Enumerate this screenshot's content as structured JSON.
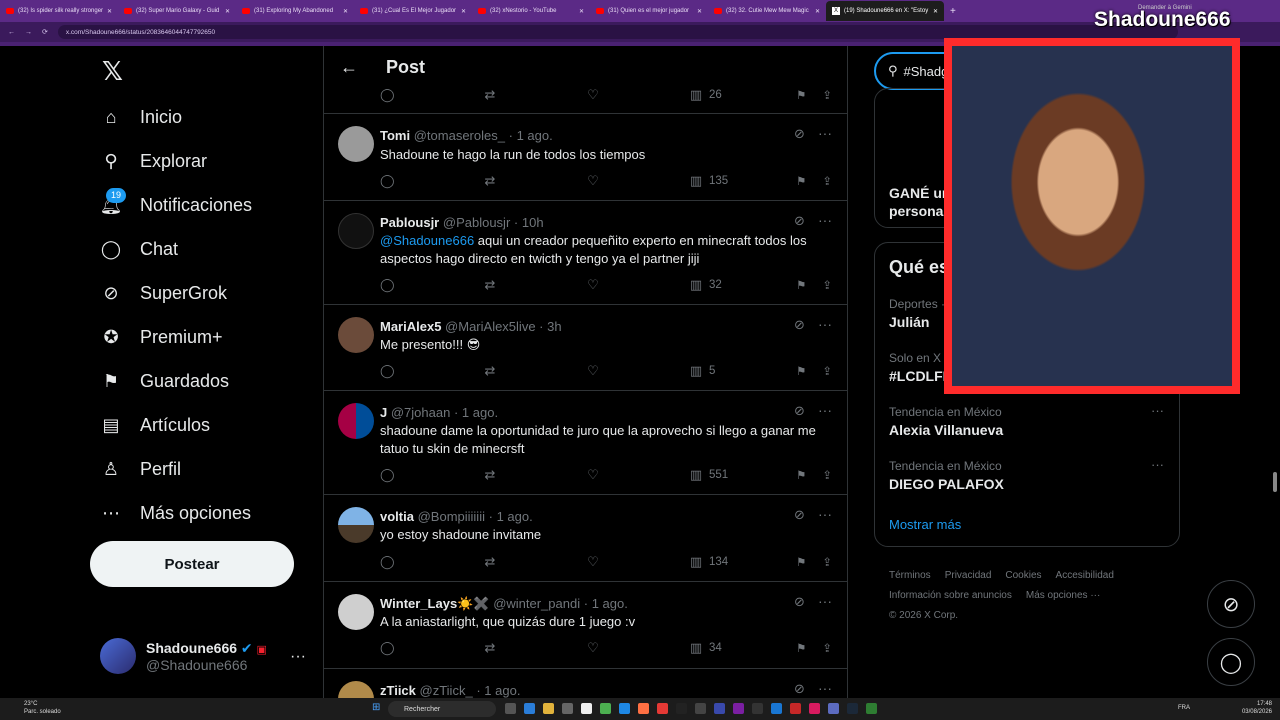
{
  "browser": {
    "tabs": [
      {
        "label": "(32) Is spider silk really stronger"
      },
      {
        "label": "(32) Super Mario Galaxy - Guid"
      },
      {
        "label": "(31) Exploring My Abandoned"
      },
      {
        "label": "(31) ¿Cual Es El Mejor Jugador"
      },
      {
        "label": "(32) xNestorio - YouTube"
      },
      {
        "label": "(31) Quien es el mejor jugador"
      },
      {
        "label": "(32) 32. Cutie Mew Mew Magic"
      },
      {
        "label": "(19) Shadoune666 en X: \"Estoy"
      }
    ],
    "url": "x.com/Shadoune666/status/2083646044747792650"
  },
  "overlay": {
    "streamer_name": "Shadoune666",
    "hint": "Demander à Gemini"
  },
  "nav": {
    "items": [
      {
        "label": "Inicio"
      },
      {
        "label": "Explorar"
      },
      {
        "label": "Notificaciones"
      },
      {
        "label": "Chat"
      },
      {
        "label": "SuperGrok"
      },
      {
        "label": "Premium+"
      },
      {
        "label": "Guardados"
      },
      {
        "label": "Artículos"
      },
      {
        "label": "Perfil"
      },
      {
        "label": "Más opciones"
      }
    ],
    "notif_badge": "19",
    "post_button": "Postear",
    "account": {
      "name": "Shadoune666",
      "handle": "@Shadoune666"
    }
  },
  "header": {
    "title": "Post"
  },
  "top_actions": {
    "views": "26"
  },
  "tweets": [
    {
      "name": "Tomi",
      "handle": "@tomaseroles_",
      "time": "1 ago.",
      "text": "Shadoune te hago la run de todos los tiempos",
      "views": "135"
    },
    {
      "name": "Pablousjr",
      "handle": "@Pablousjr",
      "time": "10h",
      "mention": "@Shadoune666",
      "text": " aqui un creador pequeñito experto en minecraft todos los aspectos hago directo en twicth y tengo ya el partner jiji",
      "views": "32"
    },
    {
      "name": "MariAlex5",
      "handle": "@MariAlex5live",
      "time": "3h",
      "text": "Me presento!!! 😎",
      "views": "5"
    },
    {
      "name": "J",
      "handle": "@7johaan",
      "time": "1 ago.",
      "text": "shadoune dame la oportunidad te juro que la aprovecho si llego a ganar me tatuo tu skin de minecrsft",
      "views": "551"
    },
    {
      "name": "voltia",
      "handle": "@Bompiiiiiii",
      "time": "1 ago.",
      "text": "yo estoy shadoune invitame",
      "views": "134"
    },
    {
      "name": "Winter_Lays☀️✖️",
      "handle": "@winter_pandi",
      "time": "1 ago.",
      "text": "A la aniastarlight, que quizás dure 1 juego :v",
      "views": "34"
    },
    {
      "name": "zTiick",
      "handle": "@zTiick_",
      "time": "1 ago."
    }
  ],
  "right": {
    "search_value": "#Shadg",
    "card1_text": [
      "GANÉ un",
      "personas"
    ],
    "trends_title": "Qué es",
    "trends": [
      {
        "context": "Deportes ·",
        "name": "Julián"
      },
      {
        "context": "Solo en X ·",
        "name": "#LCDLFM"
      },
      {
        "context": "Tendencia en México",
        "name": "Alexia Villanueva"
      },
      {
        "context": "Tendencia en México",
        "name": "DIEGO PALAFOX"
      }
    ],
    "show_more": "Mostrar más"
  },
  "footer": {
    "links": [
      "Términos",
      "Privacidad",
      "Cookies",
      "Accesibilidad",
      "Información sobre anuncios",
      "Más opciones ···"
    ],
    "copyright": "© 2026 X Corp."
  },
  "taskbar": {
    "temp": "23°C",
    "weather": "Parc. soleado",
    "search": "Rechercher",
    "lang": "FRA",
    "time": "17:48",
    "date": "03/08/2026"
  },
  "colors": {
    "accent": "#1d9bf0",
    "overlay_border": "#ff2b2b",
    "browser_chrome": "#5b2a86"
  }
}
